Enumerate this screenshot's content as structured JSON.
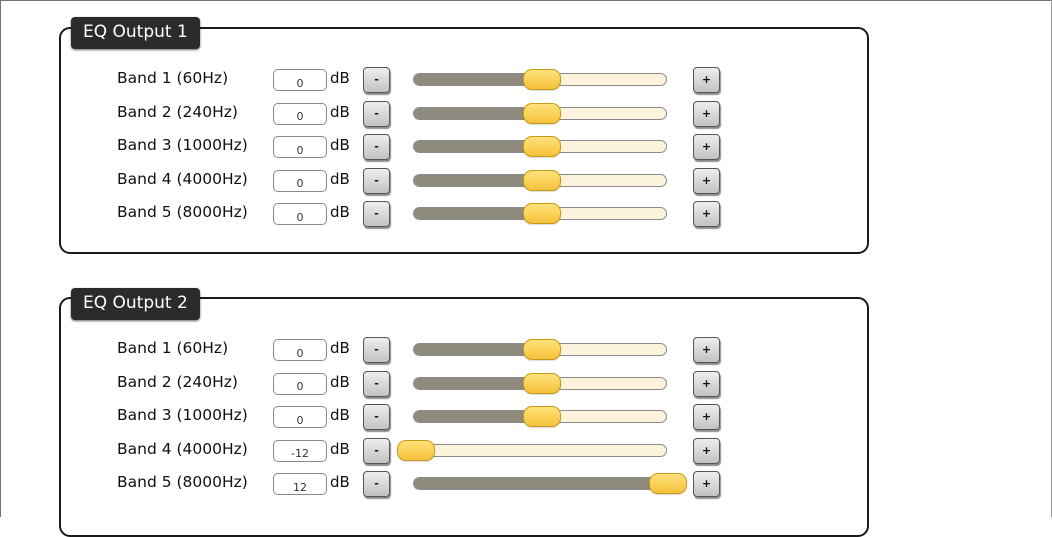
{
  "outputs": [
    {
      "title": "EQ Output 1",
      "bands": [
        {
          "label": "Band 1 (60Hz)",
          "value": "0",
          "level": 0.5
        },
        {
          "label": "Band 2 (240Hz)",
          "value": "0",
          "level": 0.5
        },
        {
          "label": "Band 3 (1000Hz)",
          "value": "0",
          "level": 0.5
        },
        {
          "label": "Band 4 (4000Hz)",
          "value": "0",
          "level": 0.5
        },
        {
          "label": "Band 5 (8000Hz)",
          "value": "0",
          "level": 0.5
        }
      ]
    },
    {
      "title": "EQ Output 2",
      "bands": [
        {
          "label": "Band 1 (60Hz)",
          "value": "0",
          "level": 0.5
        },
        {
          "label": "Band 2 (240Hz)",
          "value": "0",
          "level": 0.5
        },
        {
          "label": "Band 3 (1000Hz)",
          "value": "0",
          "level": 0.5
        },
        {
          "label": "Band 4 (4000Hz)",
          "value": "-12",
          "level": 0.0
        },
        {
          "label": "Band 5 (8000Hz)",
          "value": "12",
          "level": 1.0
        }
      ]
    }
  ],
  "unit": "dB",
  "minus_label": "-",
  "plus_label": "+",
  "colors": {
    "thumb": "#f5c23d",
    "track_filled": "#8f8a7e",
    "track_empty": "#fbf3dc",
    "legend_bg": "#2b2b2b"
  }
}
